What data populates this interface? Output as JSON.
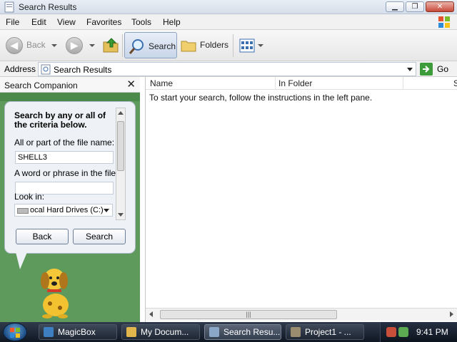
{
  "window": {
    "title": "Search Results"
  },
  "menu": {
    "items": [
      "File",
      "Edit",
      "View",
      "Favorites",
      "Tools",
      "Help"
    ]
  },
  "toolbar": {
    "back_label": "Back",
    "search_label": "Search",
    "folders_label": "Folders"
  },
  "address": {
    "label": "Address",
    "value": "Search Results",
    "go_label": "Go"
  },
  "search_companion": {
    "title": "Search Companion",
    "heading": "Search by any or all of the criteria below.",
    "filename_label": "All or part of the file name:",
    "filename_value": "SHELL3",
    "phrase_label": "A word or phrase in the file:",
    "phrase_value": "",
    "lookin_label": "Look in:",
    "lookin_value": "ocal Hard Drives (C:)",
    "back_button": "Back",
    "search_button": "Search"
  },
  "results": {
    "columns": [
      "Name",
      "In Folder",
      "S"
    ],
    "message": "To start your search, follow the instructions in the left pane."
  },
  "taskbar": {
    "tasks": [
      {
        "label": "MagicBox",
        "color": "#3e7fc1"
      },
      {
        "label": "My Docum...",
        "color": "#e0b64c"
      },
      {
        "label": "Search Resu...",
        "color": "#8aa7c8"
      },
      {
        "label": "Project1 - ...",
        "color": "#9a8c6e"
      }
    ],
    "clock": "9:41 PM"
  },
  "colors": {
    "companion_green": "#5e9a5c",
    "go_green": "#3e9b3a",
    "taskbar_dark": "#1b2430"
  }
}
